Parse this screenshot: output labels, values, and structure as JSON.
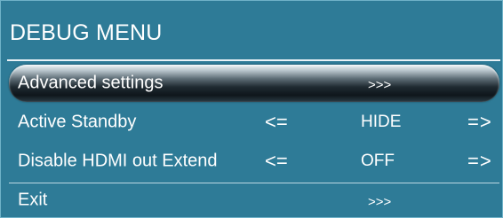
{
  "menu": {
    "title": "DEBUG MENU",
    "items": [
      {
        "label": "Advanced settings",
        "left_arrow": "",
        "value": ">>>",
        "right_arrow": "",
        "selected": true
      },
      {
        "label": "Active Standby",
        "left_arrow": "<=",
        "value": "HIDE",
        "right_arrow": "=>",
        "selected": false
      },
      {
        "label": "Disable HDMI out Extend",
        "left_arrow": "<=",
        "value": "OFF",
        "right_arrow": "=>",
        "selected": false
      },
      {
        "label": "Exit",
        "left_arrow": "",
        "value": ">>>",
        "right_arrow": "",
        "selected": false
      }
    ]
  },
  "colors": {
    "background": "#2e7b97",
    "text": "#ffffff",
    "highlight": "#1f2a31"
  }
}
